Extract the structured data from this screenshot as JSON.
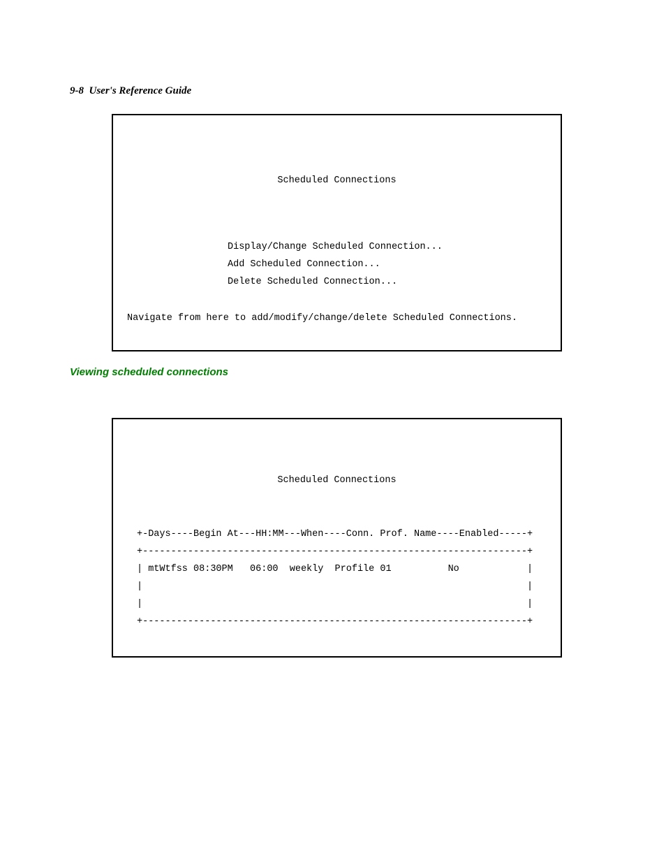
{
  "header": {
    "page_num": "9-8",
    "title": "User's Reference Guide"
  },
  "terminal1": {
    "title": "Scheduled Connections",
    "menu": {
      "display_change": "Display/Change Scheduled Connection...",
      "add": "Add Scheduled Connection...",
      "delete": "Delete Scheduled Connection..."
    },
    "nav_text": "Navigate from here to add/modify/change/delete Scheduled Connections."
  },
  "section_heading": "Viewing scheduled connections",
  "terminal2": {
    "title": "Scheduled Connections",
    "header_line": "+-Days----Begin At---HH:MM---When----Conn. Prof. Name----Enabled-----+",
    "sep_top": "+--------------------------------------------------------------------+",
    "rows": [
      {
        "days": "mtWtfss",
        "begin_at": "08:30PM",
        "hhmm": "06:00",
        "when": "weekly",
        "profile": "Profile 01",
        "enabled": "No"
      }
    ],
    "row_line": "| mtWtfss 08:30PM   06:00  weekly  Profile 01          No            |",
    "blank_line": "|                                                                    |",
    "sep_bottom": "+--------------------------------------------------------------------+"
  }
}
